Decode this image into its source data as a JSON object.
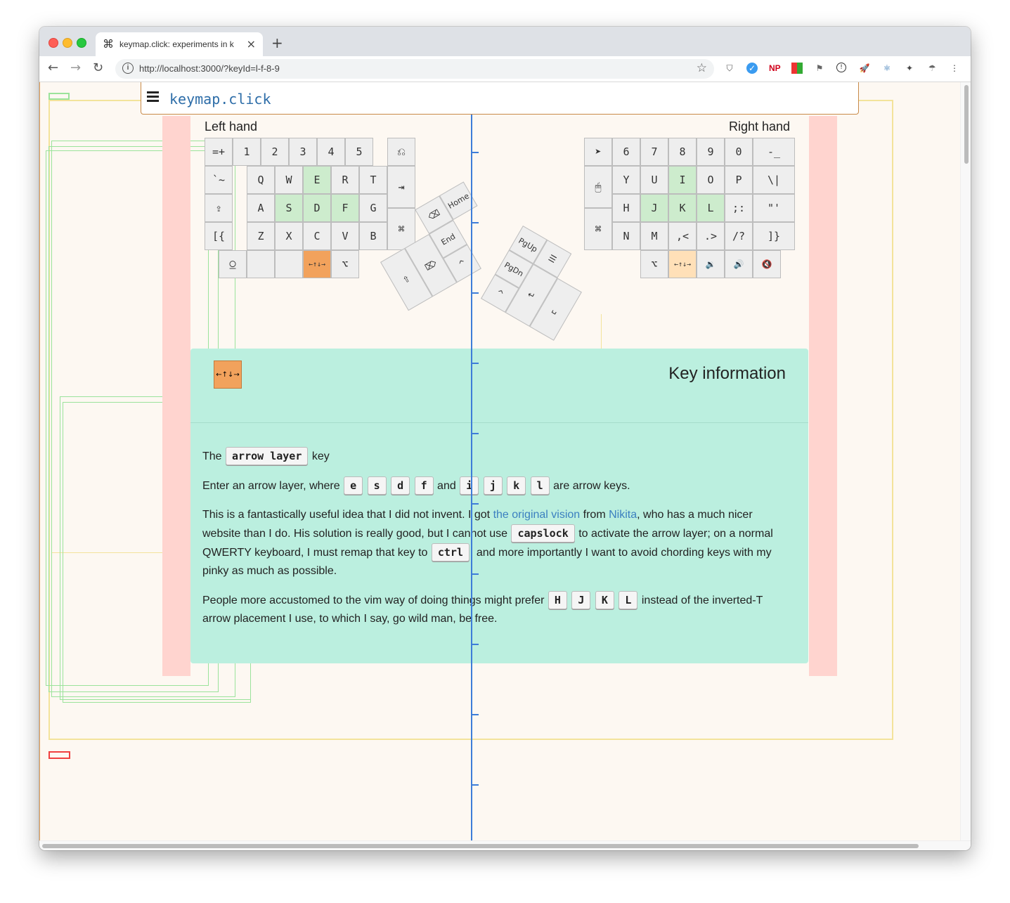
{
  "browser": {
    "tab_icon": "⌘",
    "tab_title": "keymap.click: experiments in k",
    "tab_close": "×",
    "new_tab": "+",
    "url": "http://localhost:3000/?keyId=l-f-8-9",
    "extensions": [
      "ublock-icon",
      "grammar-icon",
      "np-icon",
      "multi-icon",
      "flag-icon",
      "onepassword-icon",
      "rocket-icon",
      "react-icon",
      "puzzle-icon",
      "avatar-icon",
      "menu-icon"
    ]
  },
  "header": {
    "brand": "keymap.click"
  },
  "hands": {
    "left_label": "Left hand",
    "right_label": "Right hand"
  },
  "left_keys": [
    "=+",
    "1",
    "2",
    "3",
    "4",
    "5",
    "⎌",
    "`~",
    "Q",
    "W",
    "E",
    "R",
    "T",
    "⇥",
    "⇪",
    "A",
    "S",
    "D",
    "F",
    "G",
    "⌘",
    "[{",
    "Z",
    "X",
    "C",
    "V",
    "B",
    "⍜",
    "",
    "",
    "←↑↓→",
    "⌥"
  ],
  "left_thumb": [
    "⌫",
    "Home",
    "⇧",
    "⌦",
    "End",
    "^"
  ],
  "right_keys": [
    "➤",
    "6",
    "7",
    "8",
    "9",
    "0",
    "-_",
    "🖱",
    "Y",
    "U",
    "I",
    "O",
    "P",
    "\\|",
    "H",
    "J",
    "K",
    "L",
    ";:",
    "\"'",
    "⌘",
    "N",
    "M",
    ",<",
    ".>",
    "/?",
    "]}",
    "⌥",
    "←↑↓→",
    "🔉",
    "🔊",
    "🔇"
  ],
  "right_thumb": [
    "PgUp",
    "☰",
    "PgDn",
    "↵",
    "␣",
    "^"
  ],
  "info": {
    "key_label": "←↑↓→",
    "title": "Key information",
    "p1_pre": "The",
    "p1_kbd": "arrow layer",
    "p1_post": "key",
    "p2_pre": "Enter an arrow layer, where",
    "p2_keys_a": [
      "e",
      "s",
      "d",
      "f"
    ],
    "p2_and": "and",
    "p2_keys_b": [
      "i",
      "j",
      "k",
      "l"
    ],
    "p2_post": "are arrow keys.",
    "p3_a": "This is a fantastically useful idea that I did not invent. I got",
    "p3_link1": "the original vision",
    "p3_b": "from",
    "p3_link2": "Nikita",
    "p3_c": ", who has a much nicer website than I do. His solution is really good, but I cannot use",
    "p3_kbd1": "capslock",
    "p3_d": "to activate the arrow layer; on a normal QWERTY keyboard, I must remap that key to",
    "p3_kbd2": "ctrl",
    "p3_e": ", and more importantly I want to avoid chording keys with my pinky as much as possible.",
    "p4_a": "People more accustomed to the vim way of doing things might prefer",
    "p4_keys": [
      "H",
      "J",
      "K",
      "L"
    ],
    "p4_b": "instead of the inverted-T arrow placement I use, to which I say, go wild man, be free."
  }
}
